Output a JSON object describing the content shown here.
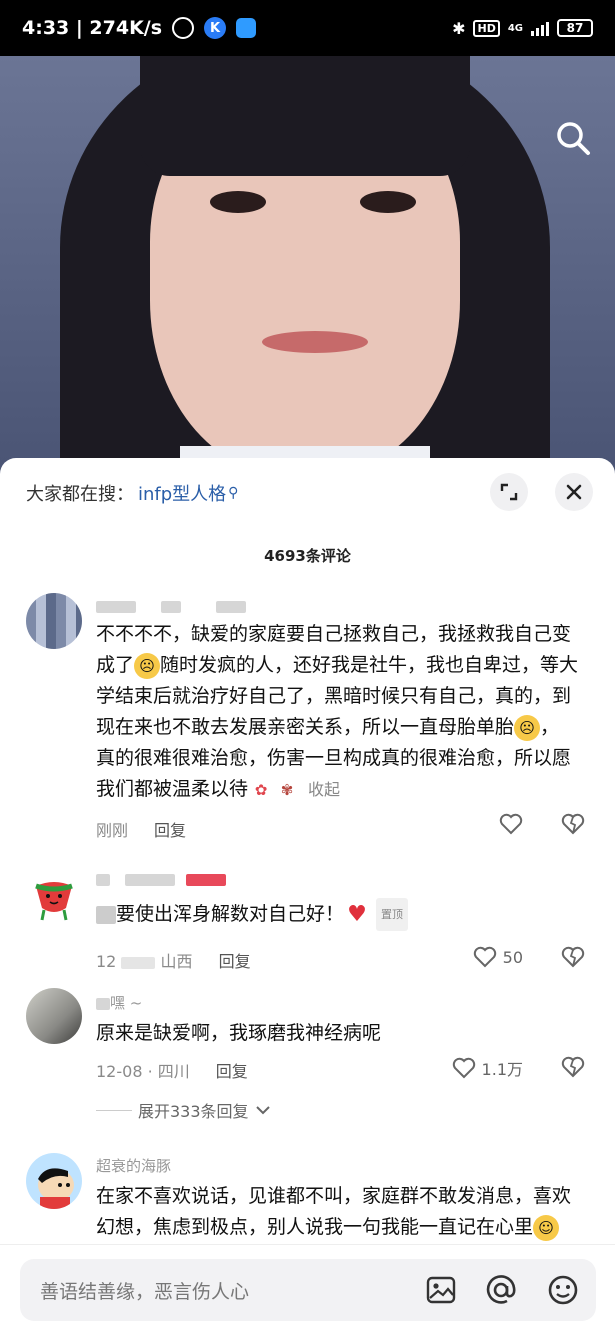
{
  "status_bar": {
    "time_speed": "4:33 | 274K/s",
    "hd": "HD",
    "network": "4G",
    "battery": "87"
  },
  "video": {
    "search_icon": "search-icon"
  },
  "sheet": {
    "hot_search_prefix": "大家都在搜：",
    "hot_search_keyword": "infp型人格",
    "comment_count": "4693条评论",
    "comments": [
      {
        "text_1": "不不不不，缺爱的家庭要自己拯救自己，我拯救我自己变",
        "text_2a": "成了",
        "text_2b": "随时发疯的人，还好我是社牛，我也自卑过，等大",
        "text_3": "学结束后就治疗好自己了，黑暗时候只有自己，真的，到",
        "text_4a": "现在来也不敢去发展亲密关系，所以一直母胎单胎",
        "text_4b": "，",
        "text_5": "真的很难很难治愈，伤害一旦构成真的很难治愈，所以愿",
        "text_6": "我们都被温柔以待",
        "collapse": "收起",
        "time": "刚刚",
        "reply": "回复"
      },
      {
        "text_1": "要使出浑身解数对自己好！",
        "pin": "置顶",
        "time_partial": "12",
        "location": "山西",
        "reply": "回复",
        "likes": "50"
      },
      {
        "username_partial": "嘿 ~",
        "text_1": "原来是缺爱啊，我琢磨我神经病呢",
        "time": "12-08",
        "location": "四川",
        "reply": "回复",
        "likes": "1.1万"
      },
      {
        "username": "超衰的海豚",
        "text_1": "在家不喜欢说话，见谁都不叫，家庭群不敢发消息，喜欢",
        "text_2": "幻想，焦虑到极点，别人说我一句我能一直记在心里"
      }
    ],
    "expand_replies": "展开333条回复"
  },
  "input_bar": {
    "placeholder": "善语结善缘，恶言伤人心"
  }
}
